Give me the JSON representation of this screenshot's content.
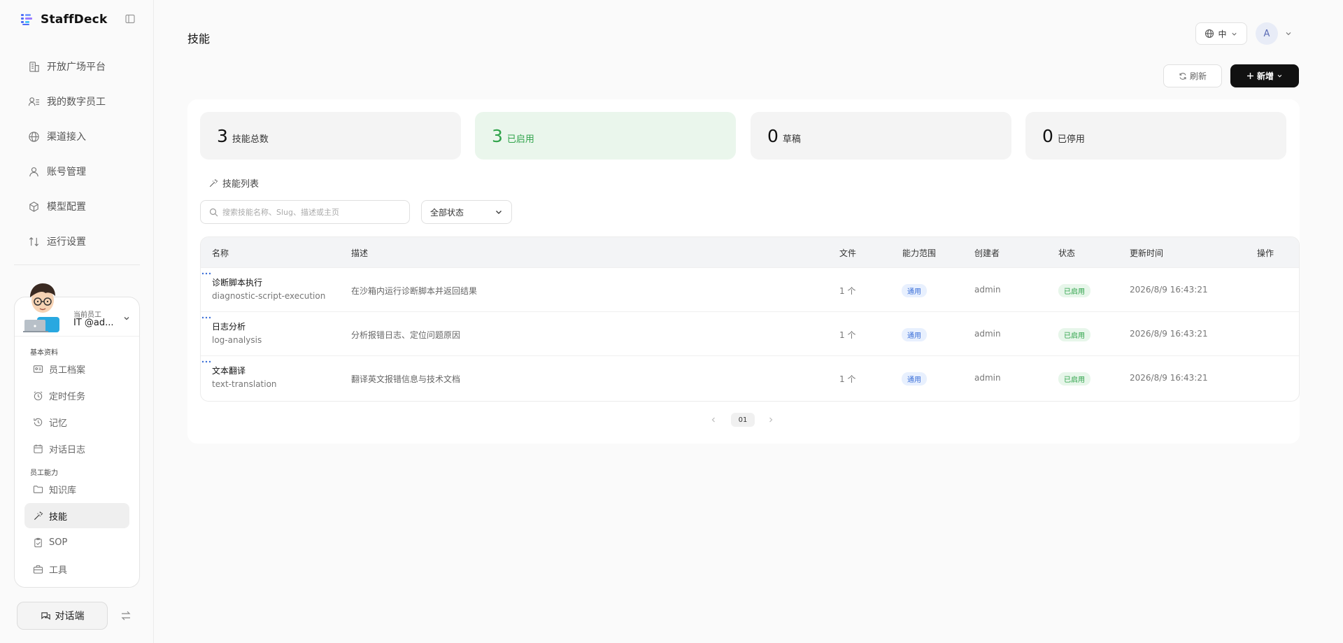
{
  "app": {
    "name": "StaffDeck"
  },
  "nav": {
    "items": [
      {
        "label": "开放广场平台",
        "icon": "building-icon"
      },
      {
        "label": "我的数字员工",
        "icon": "users-icon"
      },
      {
        "label": "渠道接入",
        "icon": "globe-icon"
      },
      {
        "label": "账号管理",
        "icon": "user-icon"
      },
      {
        "label": "模型配置",
        "icon": "cube-icon"
      },
      {
        "label": "运行设置",
        "icon": "sort-arrows-icon"
      }
    ]
  },
  "employee": {
    "role_label": "当前员工",
    "name": "IT @ad...",
    "sections": {
      "basic": "基本资料",
      "ability": "员工能力"
    },
    "basic_items": [
      {
        "label": "员工档案",
        "icon": "id-card-icon"
      },
      {
        "label": "定时任务",
        "icon": "alarm-clock-icon"
      },
      {
        "label": "记忆",
        "icon": "history-icon"
      },
      {
        "label": "对话日志",
        "icon": "calendar-icon"
      }
    ],
    "ability_items": [
      {
        "label": "知识库",
        "icon": "folder-icon"
      },
      {
        "label": "技能",
        "icon": "magic-wand-icon",
        "active": true
      },
      {
        "label": "SOP",
        "icon": "clipboard-check-icon"
      },
      {
        "label": "工具",
        "icon": "toolbox-icon"
      }
    ]
  },
  "chat_button": {
    "label": "对话端"
  },
  "header": {
    "title": "技能",
    "lang": "中",
    "user_initial": "A"
  },
  "actions": {
    "refresh": "刷新",
    "new": "新增"
  },
  "stats": [
    {
      "value": "3",
      "label": "技能总数"
    },
    {
      "value": "3",
      "label": "已启用",
      "accent": "#2fa34a"
    },
    {
      "value": "0",
      "label": "草稿"
    },
    {
      "value": "0",
      "label": "已停用"
    }
  ],
  "list": {
    "title": "技能列表",
    "search_placeholder": "搜索技能名称、Slug、描述或主页",
    "status_filter": "全部状态"
  },
  "table": {
    "columns": {
      "name": "名称",
      "desc": "描述",
      "files": "文件",
      "scope": "能力范围",
      "creator": "创建者",
      "status": "状态",
      "updated": "更新时间",
      "ops": "操作"
    },
    "rows": [
      {
        "name": "诊断脚本执行",
        "slug": "diagnostic-script-execution",
        "desc": "在沙箱内运行诊断脚本并返回结果",
        "files": "1 个",
        "scope": "通用",
        "creator": "admin",
        "status": "已启用",
        "updated": "2026/8/9 16:43:21"
      },
      {
        "name": "日志分析",
        "slug": "log-analysis",
        "desc": "分析报错日志、定位问题原因",
        "files": "1 个",
        "scope": "通用",
        "creator": "admin",
        "status": "已启用",
        "updated": "2026/8/9 16:43:21"
      },
      {
        "name": "文本翻译",
        "slug": "text-translation",
        "desc": "翻译英文报错信息与技术文档",
        "files": "1 个",
        "scope": "通用",
        "creator": "admin",
        "status": "已启用",
        "updated": "2026/8/9 16:43:21"
      }
    ]
  },
  "pager": {
    "current": "01"
  }
}
